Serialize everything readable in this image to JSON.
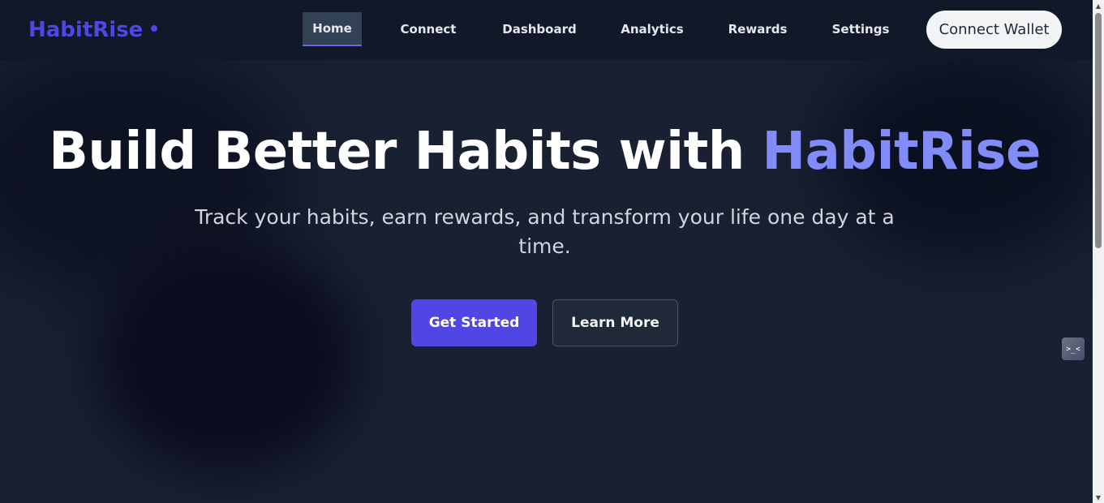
{
  "nav": {
    "logo": "HabitRise",
    "links": [
      {
        "label": "Home",
        "active": true
      },
      {
        "label": "Connect"
      },
      {
        "label": "Dashboard"
      },
      {
        "label": "Analytics"
      },
      {
        "label": "Rewards"
      },
      {
        "label": "Settings"
      }
    ],
    "connect_wallet": "Connect Wallet"
  },
  "hero": {
    "title_main": "Build Better Habits with ",
    "title_accent": "HabitRise",
    "subtitle": "Track your habits, earn rewards, and transform your life one day at a time.",
    "primary_button": "Get Started",
    "secondary_button": "Learn More"
  },
  "widget": {
    "glyph": ">_<"
  },
  "colors": {
    "accent": "#4f46e5",
    "accent_light": "#818cf8",
    "background": "#182032",
    "nav_background": "#111827"
  },
  "icons": {
    "logo_dot": "dot-icon",
    "scroll_up": "chevron-up-icon",
    "scroll_down": "chevron-down-icon"
  }
}
